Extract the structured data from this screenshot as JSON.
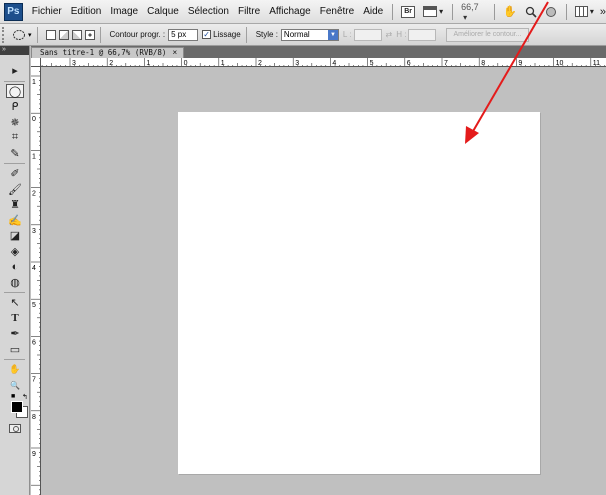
{
  "app": {
    "logo_text": "Ps"
  },
  "menu": {
    "items": [
      "Fichier",
      "Edition",
      "Image",
      "Calque",
      "Sélection",
      "Filtre",
      "Affichage",
      "Fenêtre",
      "Aide"
    ],
    "bridge_label": "Br",
    "zoom": "66,7",
    "zoom_arrow": "▾",
    "arrange_arrow": "▾",
    "workspace_arrow": "▾",
    "overflow": "»"
  },
  "options": {
    "feather_label": "Contour progr. :",
    "feather_value": "5 px",
    "antialias_label": "Lissage",
    "antialias_checked": "✓",
    "style_label": "Style :",
    "style_value": "Normal",
    "width_label": "L :",
    "height_label": "H :",
    "swap_symbol": "⇄",
    "refine_button": "Améliorer le contour..."
  },
  "toolbox": {
    "header": "»",
    "tools": [
      {
        "name": "move-tool",
        "glyph": "▸"
      },
      {
        "name": "elliptical-marquee-tool",
        "glyph": "◯"
      },
      {
        "name": "lasso-tool",
        "glyph": "ᑭ"
      },
      {
        "name": "magic-wand-tool",
        "glyph": "✵"
      },
      {
        "name": "crop-tool",
        "glyph": "⌗"
      },
      {
        "name": "eyedropper-tool",
        "glyph": "✎"
      },
      {
        "name": "healing-brush-tool",
        "glyph": "✐"
      },
      {
        "name": "brush-tool",
        "glyph": "🖌"
      },
      {
        "name": "clone-stamp-tool",
        "glyph": "♜"
      },
      {
        "name": "history-brush-tool",
        "glyph": "✍"
      },
      {
        "name": "eraser-tool",
        "glyph": "◪"
      },
      {
        "name": "paint-bucket-tool",
        "glyph": "◈"
      },
      {
        "name": "blur-tool",
        "glyph": "◐"
      },
      {
        "name": "dodge-tool",
        "glyph": "◍"
      },
      {
        "name": "path-selection-tool",
        "glyph": "↖"
      },
      {
        "name": "type-tool",
        "glyph": "T"
      },
      {
        "name": "pen-tool",
        "glyph": "✒"
      },
      {
        "name": "rectangle-tool",
        "glyph": "▭"
      },
      {
        "name": "hand-tool",
        "glyph": "✋"
      },
      {
        "name": "zoom-tool",
        "glyph": "🔍"
      }
    ]
  },
  "document": {
    "tab_title": "Sans titre-1 @ 66,7% (RVB/8)",
    "close_glyph": "×"
  },
  "ruler_top_labels": [
    "3",
    "2",
    "1",
    "0",
    "1",
    "2",
    "3",
    "4",
    "5",
    "6",
    "7",
    "8",
    "9",
    "10",
    "11"
  ],
  "ruler_left_labels": [
    "1",
    "0",
    "1",
    "2",
    "3",
    "4",
    "5",
    "6",
    "7",
    "8",
    "9"
  ],
  "annotation": {
    "color": "#e41b1b"
  }
}
